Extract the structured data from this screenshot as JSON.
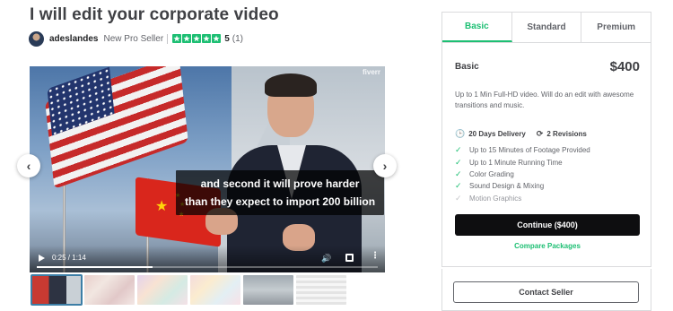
{
  "gig": {
    "title": "I will edit your corporate video",
    "seller_name": "adeslandes",
    "seller_level": "New Pro Seller",
    "rating": "5",
    "rating_count": "(1)",
    "stars": 5
  },
  "video": {
    "watermark": "fiverr",
    "subtitle_line1": "and second it will prove harder",
    "subtitle_line2": "than they expect to import 200 billion",
    "time": "0:25 / 1:14",
    "progress": 0.34
  },
  "packages": {
    "tabs": [
      "Basic",
      "Standard",
      "Premium"
    ],
    "active_tab": "Basic",
    "name": "Basic",
    "price": "$400",
    "description": "Up to 1 Min Full-HD video. Will do an edit with awesome transitions and music.",
    "delivery": "20 Days Delivery",
    "revisions": "2 Revisions",
    "features": [
      {
        "label": "Up to 15 Minutes of Footage Provided",
        "included": true
      },
      {
        "label": "Up to 1 Minute Running Time",
        "included": true
      },
      {
        "label": "Color Grading",
        "included": true
      },
      {
        "label": "Sound Design & Mixing",
        "included": true
      },
      {
        "label": "Motion Graphics",
        "included": false
      }
    ],
    "continue_label": "Continue ($400)",
    "compare_label": "Compare Packages"
  },
  "contact": {
    "label": "Contact Seller"
  },
  "colors": {
    "accent": "#1dbf73",
    "button_dark": "#0e0e10",
    "star": "#1dbf73"
  }
}
